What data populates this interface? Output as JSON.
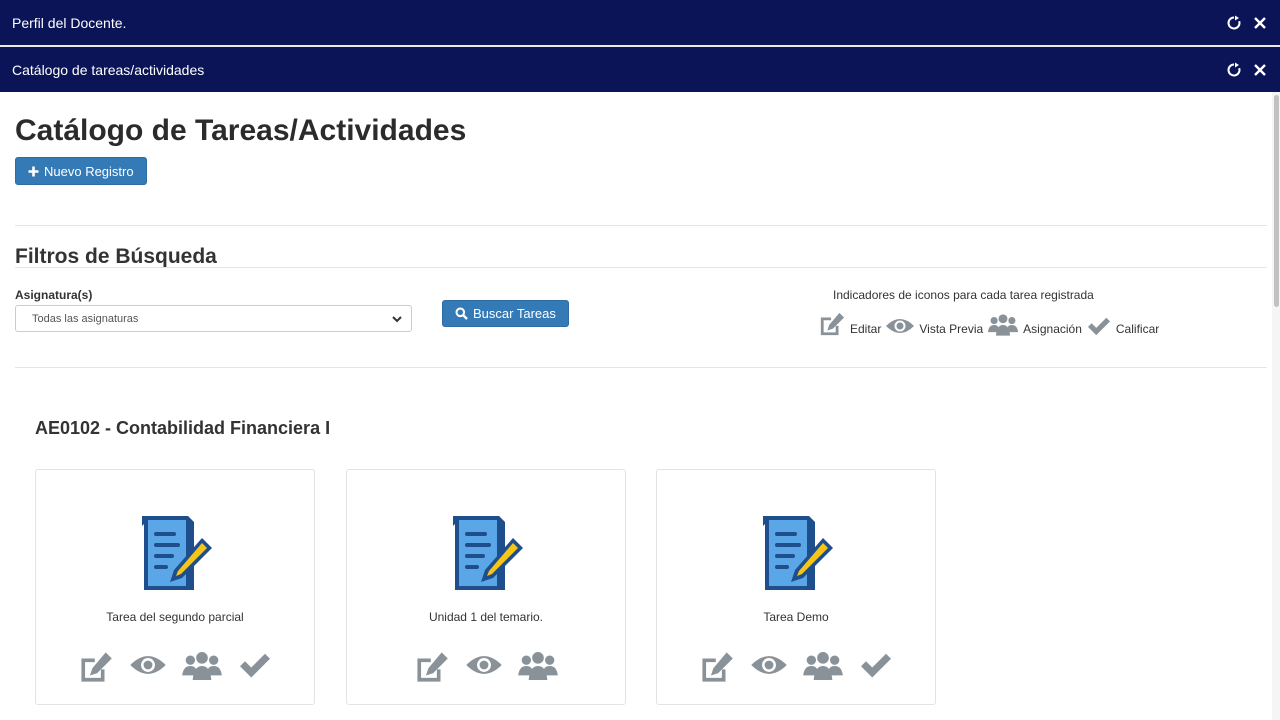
{
  "windows": {
    "outer_title": "Perfil del Docente.",
    "inner_title": "Catálogo de tareas/actividades"
  },
  "page": {
    "title": "Catálogo de Tareas/Actividades",
    "new_button": "Nuevo Registro"
  },
  "filters": {
    "title": "Filtros de Búsqueda",
    "subject_label": "Asignatura(s)",
    "subject_selected": "Todas las asignaturas",
    "search_button": "Buscar Tareas"
  },
  "legend": {
    "title": "Indicadores de iconos para cada tarea registrada",
    "edit": "Editar",
    "preview": "Vista Previa",
    "assign": "Asignación",
    "grade": "Calificar"
  },
  "subject": {
    "title": "AE0102 - Contabilidad Financiera I"
  },
  "tasks": [
    {
      "name": "Tarea del segundo parcial",
      "actions": [
        "edit-icon",
        "eye-icon",
        "users-icon",
        "check-icon"
      ]
    },
    {
      "name": "Unidad 1 del temario.",
      "actions": [
        "edit-icon",
        "eye-icon",
        "users-icon"
      ]
    },
    {
      "name": "Tarea Demo",
      "actions": [
        "edit-icon",
        "eye-icon",
        "users-icon",
        "check-icon"
      ]
    }
  ],
  "colors": {
    "titlebar": "#0a1456",
    "primary": "#337ab7",
    "icon_gray": "#8a9299"
  }
}
